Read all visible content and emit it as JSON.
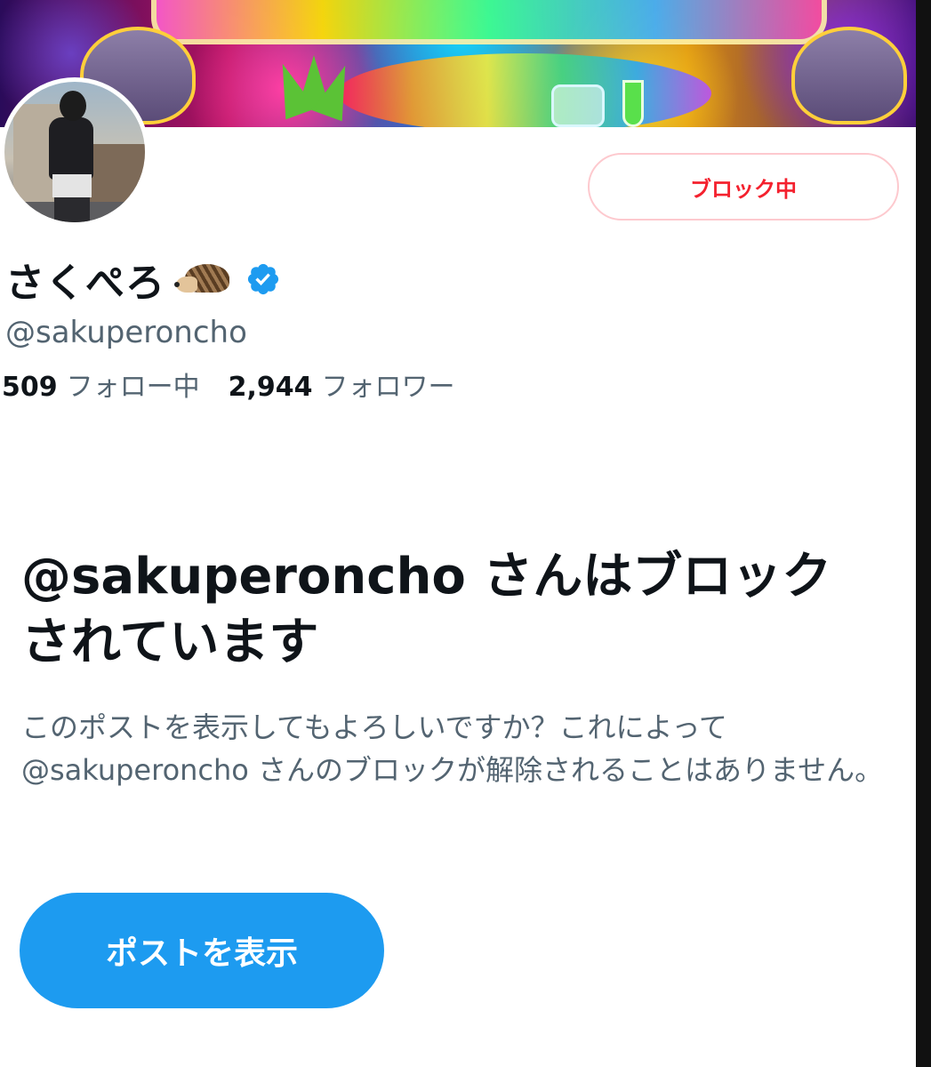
{
  "header": {
    "block_button_label": "ブロック中"
  },
  "profile": {
    "display_name": "さくぺろ",
    "handle": "@sakuperoncho",
    "following_count": "509",
    "following_label": "フォロー中",
    "followers_count": "2,944",
    "followers_label": "フォロワー"
  },
  "blocked_notice": {
    "title": "@sakuperoncho さんはブロックされています",
    "description": "このポストを表示してもよろしいですか？これによって @sakuperoncho さんのブロックが解除されることはありません。",
    "view_button_label": "ポストを表示"
  },
  "colors": {
    "block_red": "#f4212e",
    "verified_blue": "#1d9bf0",
    "button_blue": "#1d9bf0",
    "secondary_text": "#536471"
  }
}
